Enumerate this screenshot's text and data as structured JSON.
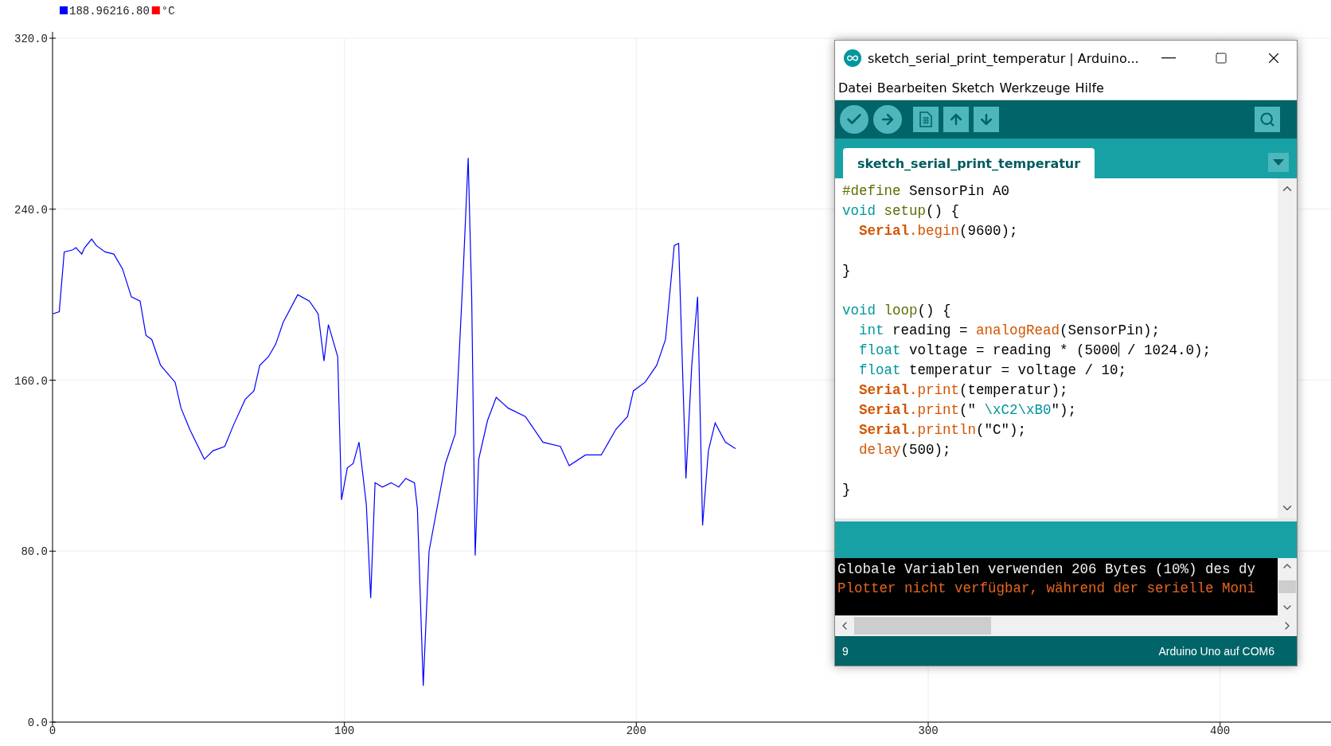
{
  "chart_data": {
    "type": "line",
    "grid": true,
    "xlim": [
      0,
      438
    ],
    "ylim": [
      0,
      320
    ],
    "xticks": [
      0,
      100,
      200,
      300,
      400
    ],
    "yticks": [
      {
        "value": 0,
        "label": "0.0"
      },
      {
        "value": 80,
        "label": "80.0"
      },
      {
        "value": 160,
        "label": "160.0"
      },
      {
        "value": 240,
        "label": "240.0"
      },
      {
        "value": 320,
        "label": "320.0"
      }
    ],
    "x": [
      0,
      2.3,
      4,
      7,
      8,
      10,
      11,
      13.4,
      15,
      18,
      21,
      24,
      27,
      30,
      32,
      34,
      37,
      42,
      44,
      47,
      52,
      55,
      59,
      62,
      66,
      69,
      71,
      74,
      76.5,
      79,
      84,
      88,
      91,
      93,
      94.5,
      97.7,
      99,
      101,
      103,
      105,
      107.5,
      109,
      110.5,
      113,
      116,
      118.6,
      121,
      124,
      125,
      127,
      129,
      131.7,
      134.6,
      138,
      140.7,
      142.4,
      143.6,
      144.8,
      146,
      149,
      152,
      156,
      162,
      168,
      174,
      177,
      182.6,
      188,
      193,
      197,
      199,
      203,
      207,
      210,
      213,
      214.5,
      217,
      219,
      221,
      222.7,
      224.7,
      227,
      230.5,
      234
    ],
    "series": [
      {
        "name": "188.96216.80",
        "color": "#0000ff",
        "values": [
          191,
          192,
          220,
          221,
          222,
          219,
          222,
          226,
          223,
          220,
          219,
          212,
          199,
          197,
          181,
          179,
          167,
          159,
          147,
          137,
          123,
          127,
          129,
          139,
          151,
          155,
          167,
          171,
          177,
          187,
          200,
          197,
          191,
          169,
          186,
          171,
          104,
          119,
          121,
          131,
          102,
          58,
          112,
          110,
          112,
          110,
          114,
          112,
          100,
          17,
          80,
          100,
          121,
          135,
          211,
          264,
          199,
          78,
          123,
          141,
          152,
          147,
          143,
          131,
          129,
          120,
          125,
          125,
          137,
          143,
          155,
          159,
          167,
          179,
          223,
          224,
          114,
          167,
          199,
          92,
          127,
          140,
          131,
          128
        ]
      },
      {
        "name": "°C",
        "color": "#ff0000",
        "values": [
          null,
          null,
          null,
          null,
          null,
          null,
          null,
          null,
          null,
          null,
          null,
          null,
          null,
          null,
          null,
          null,
          null,
          null,
          null,
          null,
          null,
          null,
          null,
          null,
          null,
          null,
          null,
          null,
          null,
          null,
          null,
          null,
          null,
          null,
          null,
          null,
          null,
          null,
          null,
          null,
          null,
          null,
          null,
          null,
          null,
          null,
          null,
          null,
          null,
          null,
          null,
          null,
          null,
          null,
          null,
          null,
          null,
          null,
          null,
          null,
          null,
          null,
          null,
          null,
          null,
          null,
          null,
          null,
          null,
          null,
          null,
          null,
          null,
          null,
          null,
          null,
          null,
          null,
          null,
          null,
          null,
          null,
          null,
          null
        ]
      }
    ]
  },
  "window": {
    "title": "sketch_serial_print_temperatur | Arduino...",
    "menu": [
      "Datei",
      "Bearbeiten",
      "Sketch",
      "Werkzeuge",
      "Hilfe"
    ],
    "tabs": [
      {
        "label": "sketch_serial_print_temperatur",
        "selected": true
      }
    ],
    "code_lines": [
      {
        "kind": "code",
        "indented": false,
        "tokens": [
          {
            "text": "#define",
            "kind": "directive"
          },
          {
            "text": " SensorPin A0",
            "kind": "plain"
          }
        ]
      },
      {
        "kind": "code",
        "indented": false,
        "tokens": [
          {
            "text": "void ",
            "kind": "type"
          },
          {
            "text": "setup",
            "kind": "directive"
          },
          {
            "text": "() {",
            "kind": "plain"
          }
        ]
      },
      {
        "kind": "code",
        "indented": true,
        "tokens": [
          {
            "text": "Serial",
            "kind": "class"
          },
          {
            "text": ".begin",
            "kind": "function"
          },
          {
            "text": "(9600);",
            "kind": "plain"
          }
        ]
      },
      {
        "kind": "blank"
      },
      {
        "kind": "code",
        "indented": false,
        "tokens": [
          {
            "text": "}",
            "kind": "plain"
          }
        ]
      },
      {
        "kind": "blank"
      },
      {
        "kind": "code",
        "indented": false,
        "tokens": [
          {
            "text": "void ",
            "kind": "type"
          },
          {
            "text": "loop",
            "kind": "directive"
          },
          {
            "text": "() {",
            "kind": "plain"
          }
        ]
      },
      {
        "kind": "code",
        "indented": true,
        "tokens": [
          {
            "text": "int",
            "kind": "type"
          },
          {
            "text": " reading = ",
            "kind": "plain"
          },
          {
            "text": "analogRead",
            "kind": "function"
          },
          {
            "text": "(SensorPin);",
            "kind": "plain"
          }
        ]
      },
      {
        "kind": "code",
        "indented": true,
        "tokens": [
          {
            "text": "float",
            "kind": "type"
          },
          {
            "text": " voltage = reading * (5000",
            "kind": "plain"
          },
          {
            "kind": "cursor"
          },
          {
            "text": " / 1024.0);",
            "kind": "plain"
          }
        ]
      },
      {
        "kind": "code",
        "indented": true,
        "tokens": [
          {
            "text": "float",
            "kind": "type"
          },
          {
            "text": " temperatur = voltage / 10;",
            "kind": "plain"
          }
        ]
      },
      {
        "kind": "code",
        "indented": true,
        "tokens": [
          {
            "text": "Serial",
            "kind": "class"
          },
          {
            "text": ".print",
            "kind": "function"
          },
          {
            "text": "(temperatur);",
            "kind": "plain"
          }
        ]
      },
      {
        "kind": "code",
        "indented": true,
        "tokens": [
          {
            "text": "Serial",
            "kind": "class"
          },
          {
            "text": ".print",
            "kind": "function"
          },
          {
            "text": "(\" ",
            "kind": "plain"
          },
          {
            "text": "\\xC2\\xB0",
            "kind": "type"
          },
          {
            "text": "\");",
            "kind": "plain"
          }
        ]
      },
      {
        "kind": "code",
        "indented": true,
        "tokens": [
          {
            "text": "Serial",
            "kind": "class"
          },
          {
            "text": ".println",
            "kind": "function"
          },
          {
            "text": "(\"C\");",
            "kind": "plain"
          }
        ]
      },
      {
        "kind": "code",
        "indented": true,
        "tokens": [
          {
            "text": "delay",
            "kind": "function"
          },
          {
            "text": "(500);",
            "kind": "plain"
          }
        ]
      },
      {
        "kind": "blank"
      },
      {
        "kind": "code",
        "indented": false,
        "tokens": [
          {
            "text": "}",
            "kind": "plain"
          }
        ]
      }
    ],
    "console": [
      {
        "text": "Globale Variablen verwenden 206 Bytes (10%) des dy",
        "kind": "info"
      },
      {
        "text": "Plotter nicht verfügbar, während der serielle Moni",
        "kind": "error"
      }
    ],
    "status_bar": {
      "line": "9",
      "board": "Arduino Uno auf COM6"
    }
  }
}
